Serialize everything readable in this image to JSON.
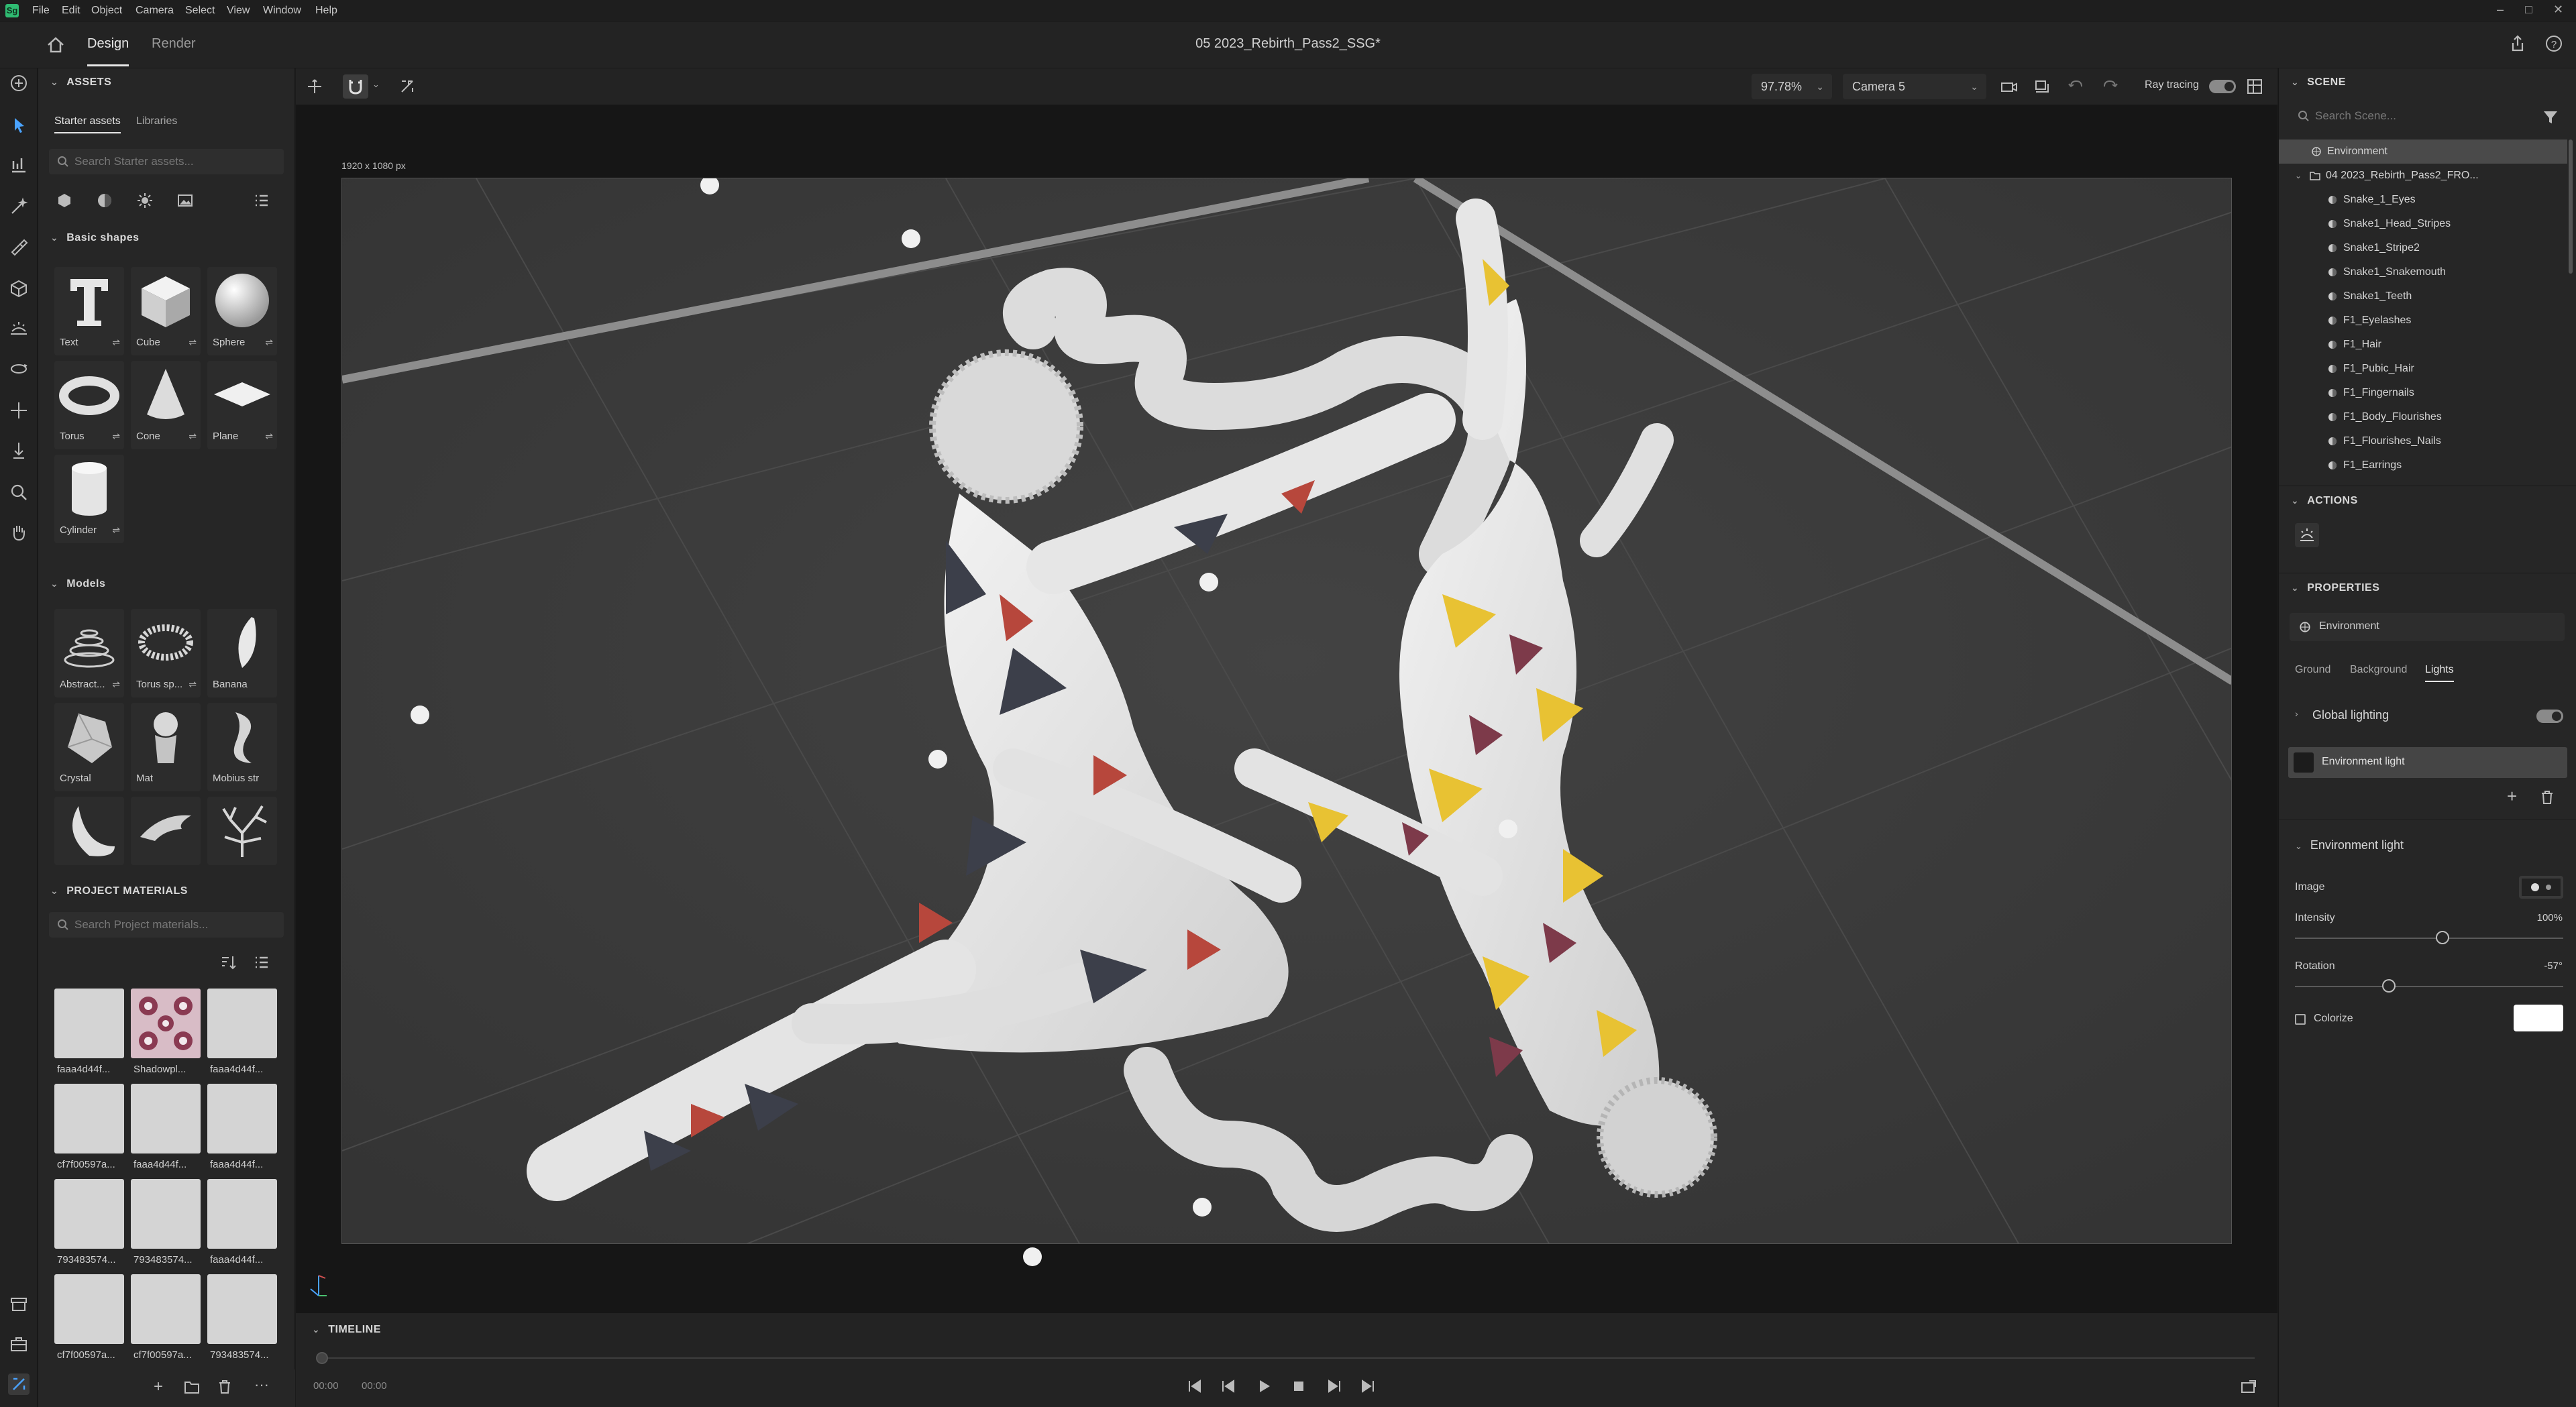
{
  "menubar": {
    "logo": "Sg",
    "items": [
      "File",
      "Edit",
      "Object",
      "Camera",
      "Select",
      "View",
      "Window",
      "Help"
    ]
  },
  "header": {
    "tabs": [
      "Design",
      "Render"
    ],
    "active_tab": "Design",
    "document_title": "05 2023_Rebirth_Pass2_SSG*"
  },
  "assets": {
    "title": "ASSETS",
    "tabs": [
      "Starter assets",
      "Libraries"
    ],
    "search_placeholder": "Search Starter assets...",
    "basic_shapes_title": "Basic shapes",
    "basic_shapes": [
      "Text",
      "Cube",
      "Sphere",
      "Torus",
      "Cone",
      "Plane",
      "Cylinder"
    ],
    "models_title": "Models",
    "models": [
      "Abstract...",
      "Torus sp...",
      "Banana",
      "Crystal",
      "Mat",
      "Mobius strip",
      "",
      "",
      ""
    ]
  },
  "project_materials": {
    "title": "PROJECT MATERIALS",
    "search_placeholder": "Search Project materials...",
    "items": [
      "faaa4d44f...",
      "Shadowpl...",
      "faaa4d44f...",
      "cf7f00597a...",
      "faaa4d44f...",
      "faaa4d44f...",
      "793483574...",
      "793483574...",
      "faaa4d44f...",
      "cf7f00597a...",
      "cf7f00597a...",
      "793483574..."
    ]
  },
  "viewport": {
    "zoom": "97.78%",
    "camera": "Camera 5",
    "ray_tracing_label": "Ray tracing",
    "canvas_size_label": "1920 x 1080 px"
  },
  "timeline": {
    "title": "TIMELINE",
    "time_current": "00:00",
    "time_total": "00:00"
  },
  "scene": {
    "title": "SCENE",
    "search_placeholder": "Search Scene...",
    "items": [
      "Environment",
      "04 2023_Rebirth_Pass2_FRO...",
      "Snake_1_Eyes",
      "Snake1_Head_Stripes",
      "Snake1_Stripe2",
      "Snake1_Snakemouth",
      "Snake1_Teeth",
      "F1_Eyelashes",
      "F1_Hair",
      "F1_Pubic_Hair",
      "F1_Fingernails",
      "F1_Body_Flourishes",
      "F1_Flourishes_Nails",
      "F1_Earrings"
    ]
  },
  "actions": {
    "title": "ACTIONS"
  },
  "properties": {
    "title": "PROPERTIES",
    "object": "Environment",
    "tabs": [
      "Ground",
      "Background",
      "Lights"
    ],
    "active_tab": "Lights",
    "global_lighting": "Global lighting",
    "env_light_item": "Environment light",
    "env_light_section": "Environment light",
    "image_label": "Image",
    "intensity_label": "Intensity",
    "intensity_value": "100%",
    "intensity_level": 0.55,
    "rotation_label": "Rotation",
    "rotation_value": "-57°",
    "rotation_level": 0.35,
    "colorize_label": "Colorize"
  },
  "colors": {
    "accent": "#2fbb72",
    "panel": "#262626",
    "canvas": "#3b3b3b"
  }
}
